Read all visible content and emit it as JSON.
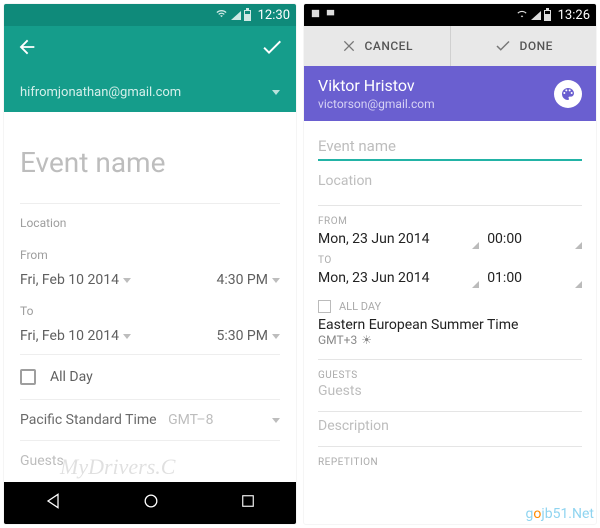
{
  "left": {
    "status": {
      "time": "12:30"
    },
    "account": "hifromjonathan@gmail.com",
    "event_name_placeholder": "Event name",
    "location_label": "Location",
    "from_label": "From",
    "from_date": "Fri, Feb 10 2014",
    "from_time": "4:30 PM",
    "to_label": "To",
    "to_date": "Fri, Feb 10 2014",
    "to_time": "5:30 PM",
    "all_day_label": "All Day",
    "timezone_name": "Pacific Standard Time",
    "timezone_offset": "GMT–8",
    "guests_label": "Guests"
  },
  "right": {
    "status": {
      "time": "13:26"
    },
    "cancel": "CANCEL",
    "done": "DONE",
    "user_name": "Viktor Hristov",
    "user_email": "victorson@gmail.com",
    "event_name_placeholder": "Event name",
    "location_placeholder": "Location",
    "from_label": "FROM",
    "from_date": "Mon, 23 Jun 2014",
    "from_time": "00:00",
    "to_label": "TO",
    "to_date": "Mon, 23 Jun 2014",
    "to_time": "01:00",
    "all_day_label": "ALL DAY",
    "timezone_name": "Eastern European Summer Time",
    "timezone_offset": "GMT+3",
    "guests_label": "GUESTS",
    "guests_placeholder": "Guests",
    "description_placeholder": "Description",
    "repetition_label": "REPETITION"
  },
  "watermarks": {
    "w1": "MyDrivers.C",
    "w2a": "g",
    "w2b": "o",
    "w2c": "jb51.Net"
  }
}
